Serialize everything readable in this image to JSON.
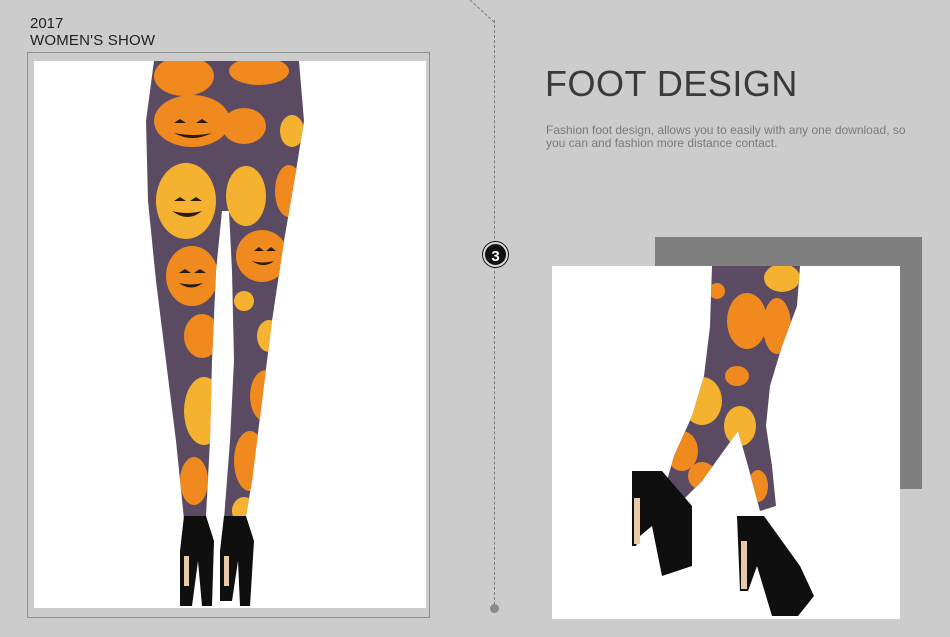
{
  "header": {
    "year": "2017",
    "show": "WOMEN'S SHOW"
  },
  "step": {
    "number": "3"
  },
  "section": {
    "title": "FOOT DESIGN",
    "description": "Fashion foot design, allows you to easily with any one download, so you can and fashion more distance contact."
  },
  "images": {
    "left": "halloween-pumpkin-leggings-back-view",
    "right": "halloween-pumpkin-leggings-side-view-heels"
  },
  "colors": {
    "background": "#cccccc",
    "leggings": "#5a4b63",
    "pumpkin": "#f08a1e",
    "pumpkin_light": "#f5b130",
    "shoe": "#0f0f0f"
  }
}
